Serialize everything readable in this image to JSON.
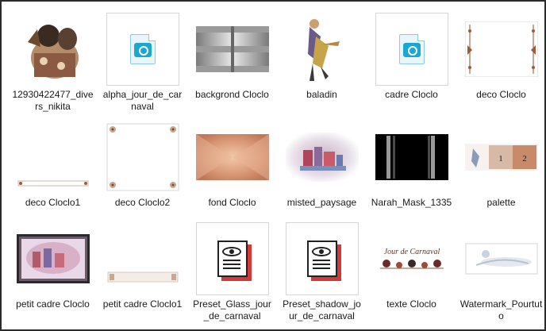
{
  "items": [
    {
      "label": "12930422477_divers_nikita",
      "icon": "portrait-thumbnail"
    },
    {
      "label": "alpha_jour_de_carnaval",
      "icon": "psd-file-icon"
    },
    {
      "label": "backgrond Cloclo",
      "icon": "pattern-thumbnail"
    },
    {
      "label": "baladin",
      "icon": "figure-thumbnail"
    },
    {
      "label": "cadre Cloclo",
      "icon": "psd-file-icon"
    },
    {
      "label": "deco Cloclo",
      "icon": "deco-thumbnail"
    },
    {
      "label": "deco Cloclo1",
      "icon": "deco-thumbnail"
    },
    {
      "label": "deco Cloclo2",
      "icon": "deco-thumbnail"
    },
    {
      "label": "fond Cloclo",
      "icon": "background-thumbnail"
    },
    {
      "label": "misted_paysage",
      "icon": "landscape-thumbnail"
    },
    {
      "label": "Narah_Mask_1335",
      "icon": "mask-thumbnail"
    },
    {
      "label": "palette",
      "icon": "palette-thumbnail",
      "swatches": [
        "1",
        "2"
      ]
    },
    {
      "label": "petit cadre Cloclo",
      "icon": "frame-thumbnail"
    },
    {
      "label": "petit cadre Cloclo1",
      "icon": "frame-thumbnail"
    },
    {
      "label": "Preset_Glass_jour_de_carnaval",
      "icon": "preset-file-icon"
    },
    {
      "label": "Preset_shadow_jour_de_carnaval",
      "icon": "preset-file-icon"
    },
    {
      "label": "texte Cloclo",
      "icon": "text-thumbnail",
      "art_text": "Jour de Carnaval"
    },
    {
      "label": "Watermark_Pourtuto",
      "icon": "watermark-thumbnail"
    }
  ]
}
